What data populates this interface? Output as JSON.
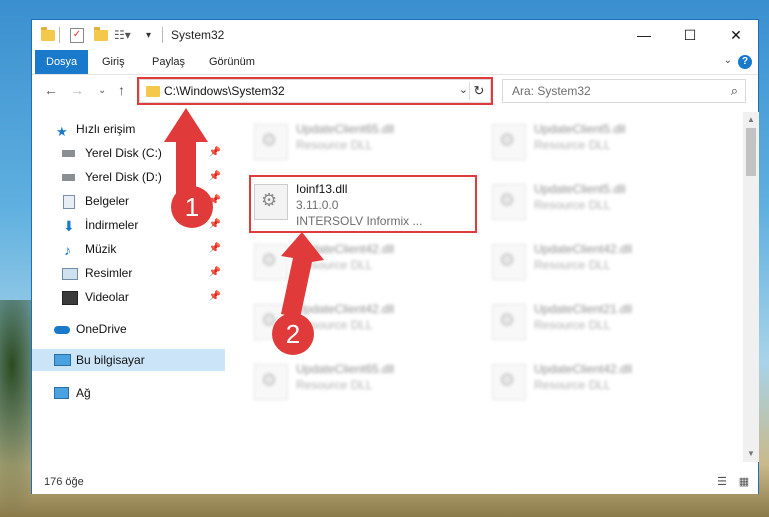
{
  "window": {
    "title": "System32",
    "minimize_glyph": "—",
    "maximize_glyph": "☐",
    "close_glyph": "✕"
  },
  "ribbon": {
    "tabs": [
      {
        "label": "Dosya",
        "active": true
      },
      {
        "label": "Giriş",
        "active": false
      },
      {
        "label": "Paylaş",
        "active": false
      },
      {
        "label": "Görünüm",
        "active": false
      }
    ],
    "help_glyph": "?"
  },
  "navigation": {
    "address_path": "C:\\Windows\\System32",
    "search_placeholder": "Ara: System32"
  },
  "sidebar": {
    "items": [
      {
        "label": "Hızlı erişim",
        "icon": "star-icon",
        "pinned": false
      },
      {
        "label": "Yerel Disk (C:)",
        "icon": "drive-icon",
        "pinned": true
      },
      {
        "label": "Yerel Disk (D:)",
        "icon": "drive-icon",
        "pinned": true
      },
      {
        "label": "Belgeler",
        "icon": "documents-icon",
        "pinned": true
      },
      {
        "label": "İndirmeler",
        "icon": "downloads-icon",
        "pinned": true
      },
      {
        "label": "Müzik",
        "icon": "music-icon",
        "pinned": true
      },
      {
        "label": "Resimler",
        "icon": "pictures-icon",
        "pinned": true
      },
      {
        "label": "Videolar",
        "icon": "videos-icon",
        "pinned": true
      },
      {
        "label": "OneDrive",
        "icon": "cloud-icon",
        "pinned": false
      },
      {
        "label": "Bu bilgisayar",
        "icon": "computer-icon",
        "pinned": false,
        "selected": true
      },
      {
        "label": "Ağ",
        "icon": "network-icon",
        "pinned": false
      }
    ]
  },
  "files": {
    "left_column": [
      {
        "name": "UpdateClient65.dll",
        "type": "Resource DLL"
      },
      {
        "name": "Ioinf13.dll",
        "version": "3.11.0.0",
        "company": "INTERSOLV Informix ...",
        "highlighted": true
      },
      {
        "name": "UpdateClient42.dll",
        "type": "Resource DLL"
      },
      {
        "name": "UpdateClient42.dll",
        "type": "Resource DLL"
      },
      {
        "name": "UpdateClient65.dll",
        "type": "Resource DLL"
      }
    ],
    "right_column": [
      {
        "name": "UpdateClient5.dll",
        "type": "Resource DLL"
      },
      {
        "name": "UpdateClient5.dll",
        "type": "Resource DLL"
      },
      {
        "name": "UpdateClient42.dll",
        "type": "Resource DLL"
      },
      {
        "name": "UpdateClient21.dll",
        "type": "Resource DLL"
      },
      {
        "name": "UpdateClient42.dll",
        "type": "Resource DLL"
      }
    ]
  },
  "status": {
    "item_count": "176 öğe"
  },
  "annotations": {
    "badge1": "1",
    "badge2": "2",
    "color": "#e03a3a"
  }
}
